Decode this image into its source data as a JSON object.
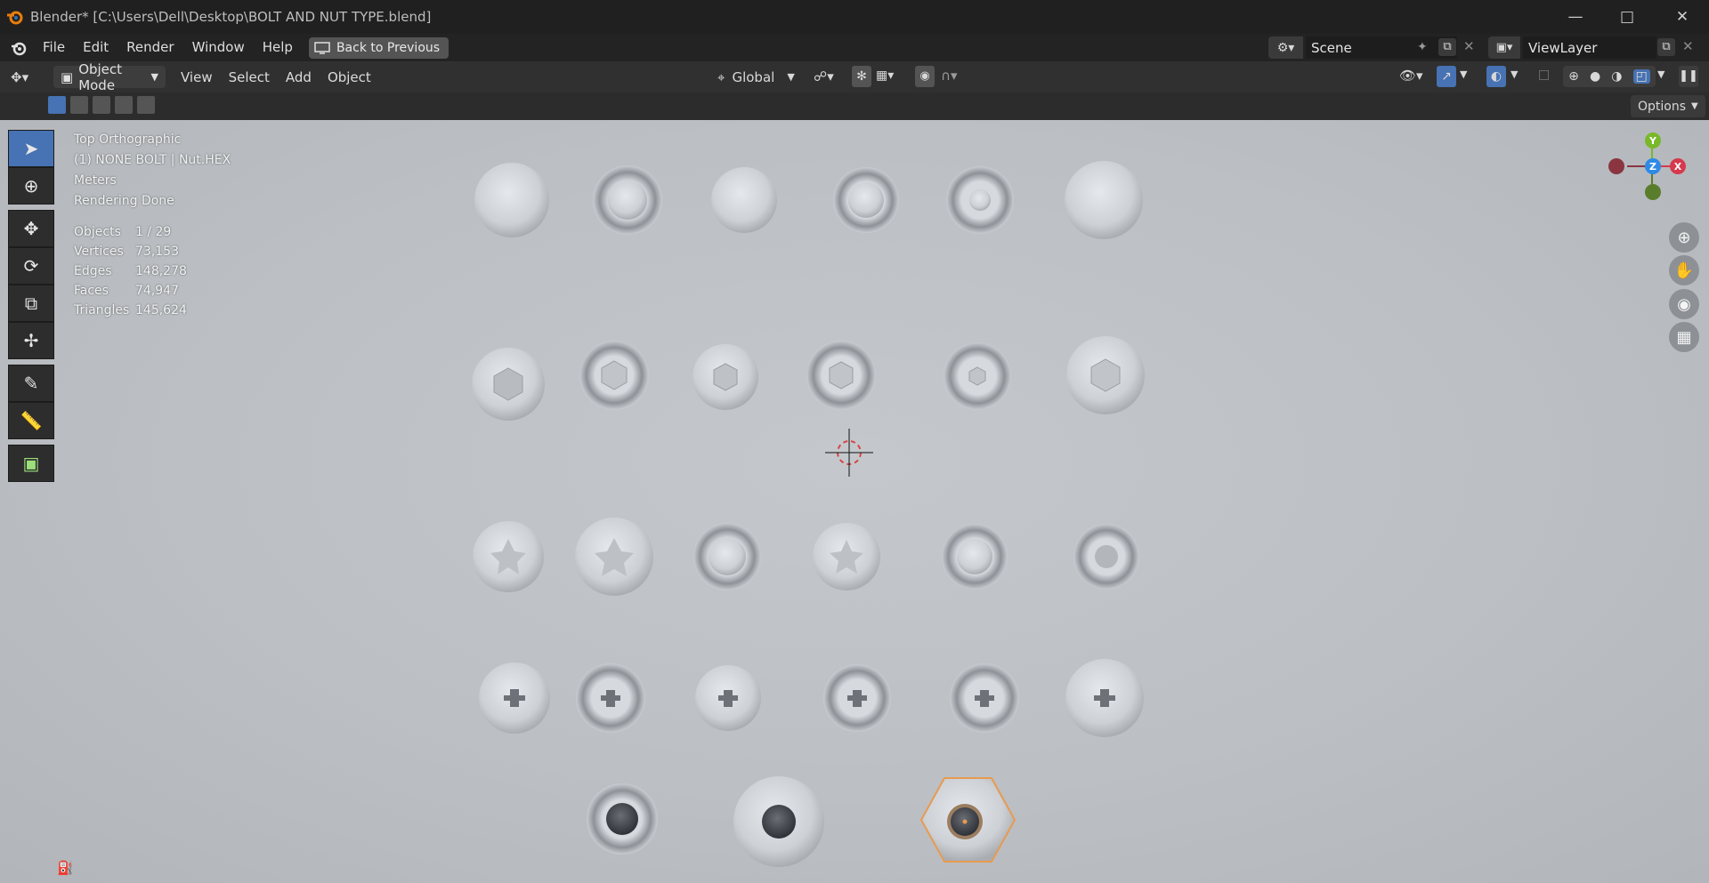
{
  "window": {
    "title": "Blender* [C:\\Users\\Dell\\Desktop\\BOLT AND NUT TYPE.blend]",
    "controls": [
      "minimize-icon",
      "maximize-icon",
      "close-icon"
    ]
  },
  "topbar": {
    "menus": [
      "File",
      "Edit",
      "Render",
      "Window",
      "Help"
    ],
    "back_label": "Back to Previous",
    "scene_label": "Scene",
    "viewlayer_label": "ViewLayer"
  },
  "header": {
    "mode_label": "Object Mode",
    "menus": [
      "View",
      "Select",
      "Add",
      "Object"
    ],
    "orientation_label": "Global",
    "options_label": "Options"
  },
  "viewport": {
    "view_name": "Top Orthographic",
    "active_object": "(1) NONE BOLT | Nut.HEX",
    "units": "Meters",
    "render_status": "Rendering Done",
    "stats": [
      {
        "label": "Objects",
        "value": "1 / 29"
      },
      {
        "label": "Vertices",
        "value": "73,153"
      },
      {
        "label": "Edges",
        "value": "148,278"
      },
      {
        "label": "Faces",
        "value": "74,947"
      },
      {
        "label": "Triangles",
        "value": "145,624"
      }
    ],
    "gizmo": {
      "y": "Y",
      "z": "Z",
      "x": "X"
    }
  },
  "colors": {
    "accent": "#4772b3",
    "selection": "#e89a50",
    "axis_x": "#d6394d",
    "axis_y": "#78b82a",
    "axis_z": "#2e8ae6"
  },
  "tools": [
    "select-box-icon",
    "cursor-icon",
    "move-icon",
    "rotate-icon",
    "scale-icon",
    "transform-icon",
    "annotate-icon",
    "measure-icon",
    "add-cube-icon"
  ]
}
